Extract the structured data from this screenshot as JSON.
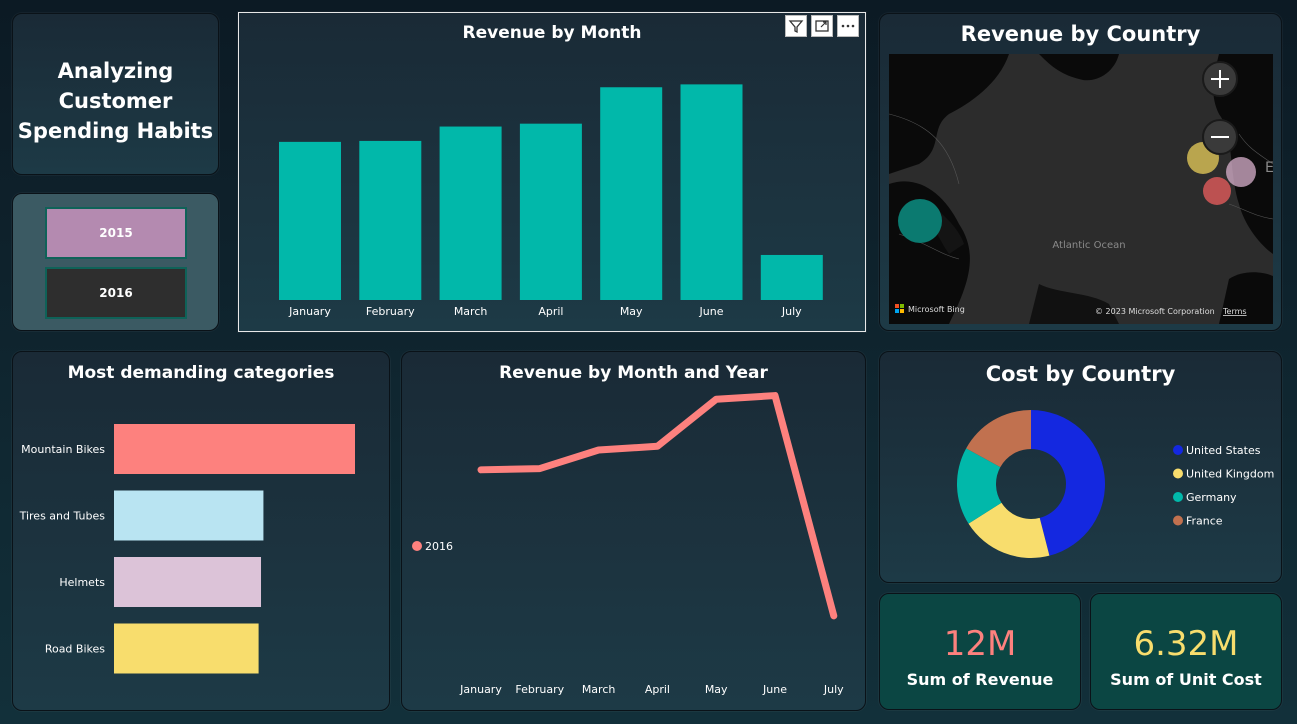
{
  "header": {
    "title": "Analyzing Customer Spending Habits"
  },
  "slicer": {
    "options": [
      "2015",
      "2016"
    ],
    "colors": {
      "2015": "#b48ab0",
      "2016": "#2e2e2e"
    }
  },
  "revenue_by_month": {
    "title": "Revenue by Month",
    "chart_data": {
      "type": "bar",
      "categories": [
        "January",
        "February",
        "March",
        "April",
        "May",
        "June",
        "July"
      ],
      "values": [
        1.65,
        1.66,
        1.81,
        1.84,
        2.22,
        2.25,
        0.47
      ],
      "color": "#01b8aa",
      "ylim": [
        0,
        2.4
      ]
    }
  },
  "revenue_by_country": {
    "title": "Revenue by Country",
    "map_label": "Atlantic Ocean",
    "attribution": "© 2023 Microsoft Corporation",
    "terms_label": "Terms",
    "bing_label": "Microsoft Bing",
    "partial_label": "EU"
  },
  "categories_chart": {
    "title": "Most demanding categories",
    "chart_data": {
      "type": "bar",
      "orientation": "horizontal",
      "categories": [
        "Mountain Bikes",
        "Tires and Tubes",
        "Helmets",
        "Road Bikes"
      ],
      "values": [
        100,
        62,
        61,
        60
      ],
      "colors": [
        "#fd817e",
        "#b9e4f2",
        "#dcc3d8",
        "#f8dd6d"
      ]
    }
  },
  "revenue_by_month_year": {
    "title": "Revenue by Month and Year",
    "legend": "2016",
    "chart_data": {
      "type": "line",
      "x": [
        "January",
        "February",
        "March",
        "April",
        "May",
        "June",
        "July"
      ],
      "series": [
        {
          "name": "2016",
          "values": [
            1.65,
            1.66,
            1.81,
            1.84,
            2.22,
            2.25,
            0.47
          ]
        }
      ],
      "color": "#fd817e",
      "ylim": [
        0,
        2.4
      ]
    }
  },
  "cost_by_country": {
    "title": "Cost by Country",
    "chart_data": {
      "type": "pie",
      "donut": true,
      "labels": [
        "United States",
        "United Kingdom",
        "Germany",
        "France"
      ],
      "values": [
        46,
        20,
        17,
        17
      ],
      "colors": [
        "#1428e0",
        "#f8dd6d",
        "#01b8aa",
        "#c1714f"
      ]
    }
  },
  "kpis": [
    {
      "value": "12M",
      "label": "Sum of Revenue",
      "color": "#fd817e"
    },
    {
      "value": "6.32M",
      "label": "Sum of Unit Cost",
      "color": "#f8dd6d"
    }
  ]
}
